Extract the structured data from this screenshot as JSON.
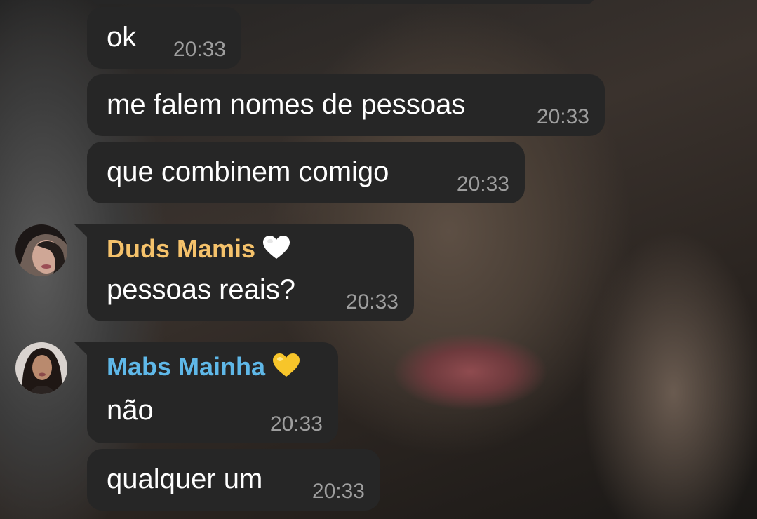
{
  "messages": [
    {
      "text": "ok",
      "time": "20:33"
    },
    {
      "text": "me falem nomes de pessoas",
      "time": "20:33"
    },
    {
      "text": "que combinem comigo",
      "time": "20:33"
    },
    {
      "sender": "Duds Mamis",
      "sender_color": "#f5c26b",
      "heart_color": "#ffffff",
      "text": "pessoas reais?",
      "time": "20:33"
    },
    {
      "sender": "Mabs Mainha",
      "sender_color": "#5fb8e8",
      "heart_color": "#f7c52a",
      "text": "não",
      "time": "20:33"
    },
    {
      "text": "qualquer um",
      "time": "20:33"
    }
  ],
  "colors": {
    "bubble": "#262626",
    "message_text": "#ffffff",
    "timestamp": "#9e9e9e"
  },
  "icons": [
    "white-heart-icon",
    "yellow-heart-icon",
    "avatar-duds",
    "avatar-mabs"
  ]
}
